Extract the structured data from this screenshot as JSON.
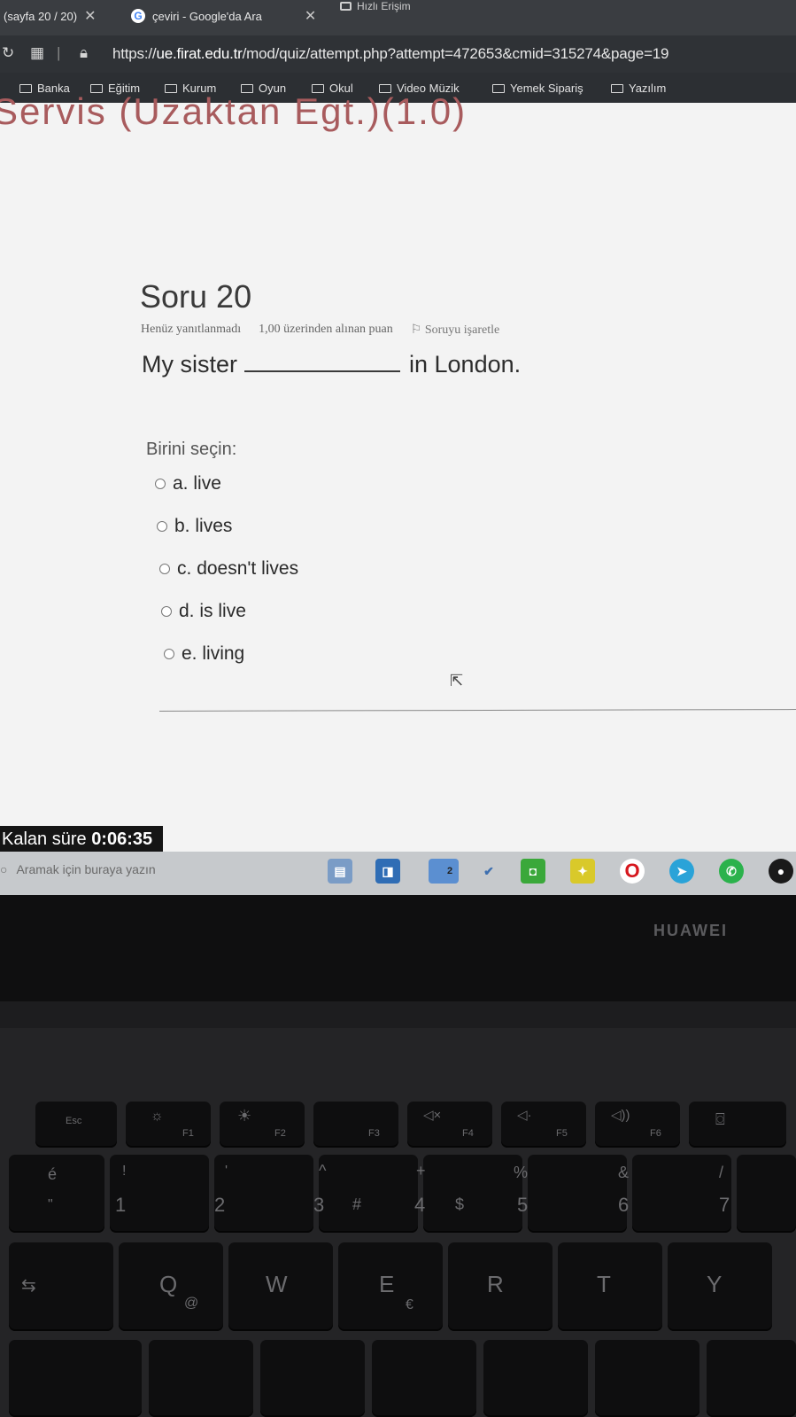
{
  "browser": {
    "tabs": [
      {
        "label": "(sayfa 20 / 20)"
      },
      {
        "label": "çeviri - Google'da Ara"
      }
    ],
    "quick_access": "Hızlı Erişim",
    "url": {
      "prefix": "https://",
      "host": "ue.firat.edu.tr",
      "path": "/mod/quiz/attempt.php?attempt=472653&cmid=315274&page=19"
    },
    "bookmarks": [
      "Banka",
      "Eğitim",
      "Kurum",
      "Oyun",
      "Okul",
      "Video Müzik",
      "Yemek Sipariş",
      "Yazılım"
    ]
  },
  "quiz": {
    "course_title": "Servis (Uzaktan Egt.)(1.0)",
    "question_title": "Soru 20",
    "status": "Henüz yanıtlanmadı",
    "points": "1,00 üzerinden alınan puan",
    "flag_label": "Soruyu işaretle",
    "question_before": "My sister",
    "question_after": "in London.",
    "choose_label": "Birini seçin:",
    "options": [
      {
        "letter": "a.",
        "text": "live",
        "selected": false
      },
      {
        "letter": "b.",
        "text": "lives",
        "selected": false
      },
      {
        "letter": "c.",
        "text": "doesn't lives",
        "selected": false
      },
      {
        "letter": "d.",
        "text": "is live",
        "selected": false
      },
      {
        "letter": "e.",
        "text": "living",
        "selected": false
      }
    ],
    "timer_label": "Kalan süre",
    "timer_value": "0:06:35"
  },
  "taskbar": {
    "search_placeholder": "Aramak için buraya yazın",
    "badge_count": "2"
  },
  "laptop": {
    "brand": "HUAWEI",
    "keys": {
      "esc": "Esc",
      "f1": "F1",
      "f2": "F2",
      "f3": "F3",
      "f4": "F4",
      "f5": "F5",
      "f6": "F6",
      "k1": "1",
      "k2": "2",
      "k3": "3",
      "k4": "4",
      "k5": "5",
      "k6": "6",
      "k7": "7",
      "q": "Q",
      "w": "W",
      "e": "E",
      "r": "R",
      "t": "T",
      "y": "Y"
    }
  },
  "colors": {
    "course_title": "#a85b5d",
    "timer_bg": "#151515"
  }
}
